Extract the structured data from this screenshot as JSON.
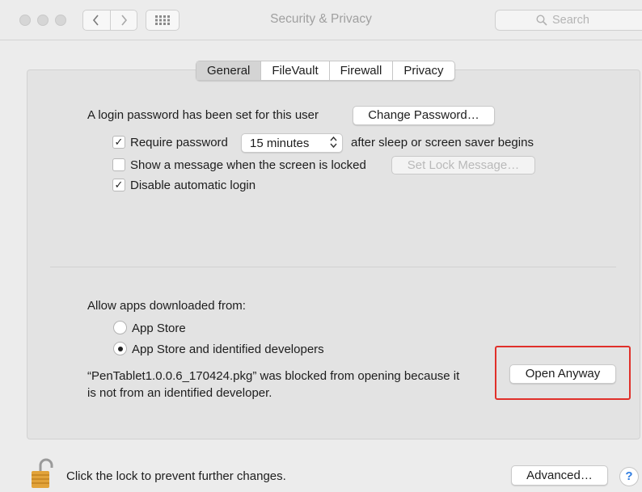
{
  "window": {
    "title": "Security & Privacy",
    "search_placeholder": "Search",
    "nav": {
      "back_glyph": "‹",
      "forward_glyph": "›"
    }
  },
  "tabs": [
    {
      "label": "General",
      "active": true
    },
    {
      "label": "FileVault",
      "active": false
    },
    {
      "label": "Firewall",
      "active": false
    },
    {
      "label": "Privacy",
      "active": false
    }
  ],
  "general": {
    "login_text": "A login password has been set for this user",
    "change_password_label": "Change Password…",
    "require_password": {
      "label": "Require password",
      "checked": true,
      "select_value": "15 minutes",
      "suffix": "after sleep or screen saver begins"
    },
    "show_message": {
      "label": "Show a message when the screen is locked",
      "checked": false,
      "button_label": "Set Lock Message…"
    },
    "disable_auto_login": {
      "label": "Disable automatic login",
      "checked": true
    }
  },
  "apps": {
    "heading": "Allow apps downloaded from:",
    "options": [
      {
        "label": "App Store",
        "selected": false
      },
      {
        "label": "App Store and identified developers",
        "selected": true
      }
    ],
    "blocked_line1": "“PenTablet1.0.0.6_170424.pkg” was blocked from opening because it",
    "blocked_line2": "is not from an identified developer.",
    "open_anyway_label": "Open Anyway"
  },
  "footer": {
    "lock_text": "Click the lock to prevent further changes.",
    "advanced_label": "Advanced…",
    "help_label": "?"
  },
  "colors": {
    "highlight": "#e0302a",
    "lock": "#e2a33a",
    "help": "#2f7de1"
  }
}
